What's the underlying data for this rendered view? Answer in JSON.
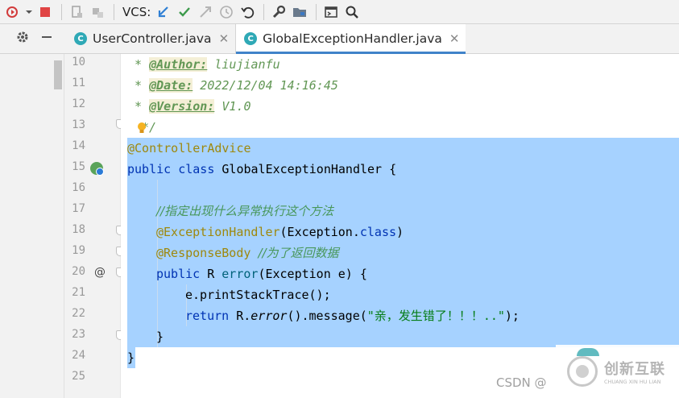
{
  "toolbar": {
    "vcs_label": "VCS:",
    "icons": [
      "run-debug-icon",
      "dropdown-arrow-icon",
      "stop-icon",
      "device-icon",
      "package-icon",
      "vcs-update-icon",
      "vcs-commit-icon",
      "vcs-compare-icon",
      "history-icon",
      "revert-icon",
      "settings-wrench-icon",
      "project-structure-icon",
      "terminal-icon",
      "search-icon"
    ]
  },
  "tabs": [
    {
      "label": "UserController.java",
      "active": false
    },
    {
      "label": "GlobalExceptionHandler.java",
      "active": true
    }
  ],
  "lines": [
    {
      "num": "10",
      "code": "doc_author"
    },
    {
      "num": "11",
      "code": "doc_date"
    },
    {
      "num": "12",
      "code": "doc_version"
    },
    {
      "num": "13",
      "code": "doc_end"
    },
    {
      "num": "14",
      "code": "ann_advice"
    },
    {
      "num": "15",
      "code": "class_decl"
    },
    {
      "num": "16",
      "code": ""
    },
    {
      "num": "17",
      "code": "comment"
    },
    {
      "num": "18",
      "code": "ann_handler"
    },
    {
      "num": "19",
      "code": "ann_body"
    },
    {
      "num": "20",
      "code": "method_decl"
    },
    {
      "num": "21",
      "code": "print_stack"
    },
    {
      "num": "22",
      "code": "return_stmt"
    },
    {
      "num": "23",
      "code": "close_method"
    },
    {
      "num": "24",
      "code": "close_class"
    },
    {
      "num": "25",
      "code": ""
    }
  ],
  "code": {
    "doc_star": " * ",
    "author_tag": "@Author:",
    "author_val": " liujianfu",
    "date_tag": "@Date:",
    "date_val": " 2022/12/04 14:16:45",
    "version_tag": "@Version:",
    "version_val": " V1.0",
    "doc_close": "*/",
    "controller_advice": "@ControllerAdvice",
    "kw_public": "public",
    "kw_class": "class",
    "class_name": "GlobalExceptionHandler",
    "open_brace": "{",
    "comment_zh": "//指定出现什么异常执行这个方法",
    "exception_handler": "@ExceptionHandler",
    "exception_arg_pre": "(Exception.",
    "kw_class_lit": "class",
    "exception_arg_post": ")",
    "response_body": "@ResponseBody",
    "comment_body": "//为了返回数据",
    "return_type": "R",
    "method_name": "error",
    "method_params": "(Exception e) {",
    "print_stmt": "e.printStackTrace();",
    "kw_return": "return",
    "r_call": "R.",
    "error_static": "error",
    "chain": "().message(",
    "message_str": "\"亲，发生错了！！！..\"",
    "chain_end": ");",
    "close_brace": "}"
  },
  "watermark": {
    "text": "CSDN @",
    "brand_cn": "创新互联",
    "brand_en": "CHUANG XIN HU LIAN"
  },
  "colors": {
    "selection": "#a6d2ff",
    "keyword": "#0033b3",
    "annotation": "#9e880d",
    "javadoc": "#629755",
    "string": "#067d17",
    "active_tab_underline": "#4083c9"
  }
}
